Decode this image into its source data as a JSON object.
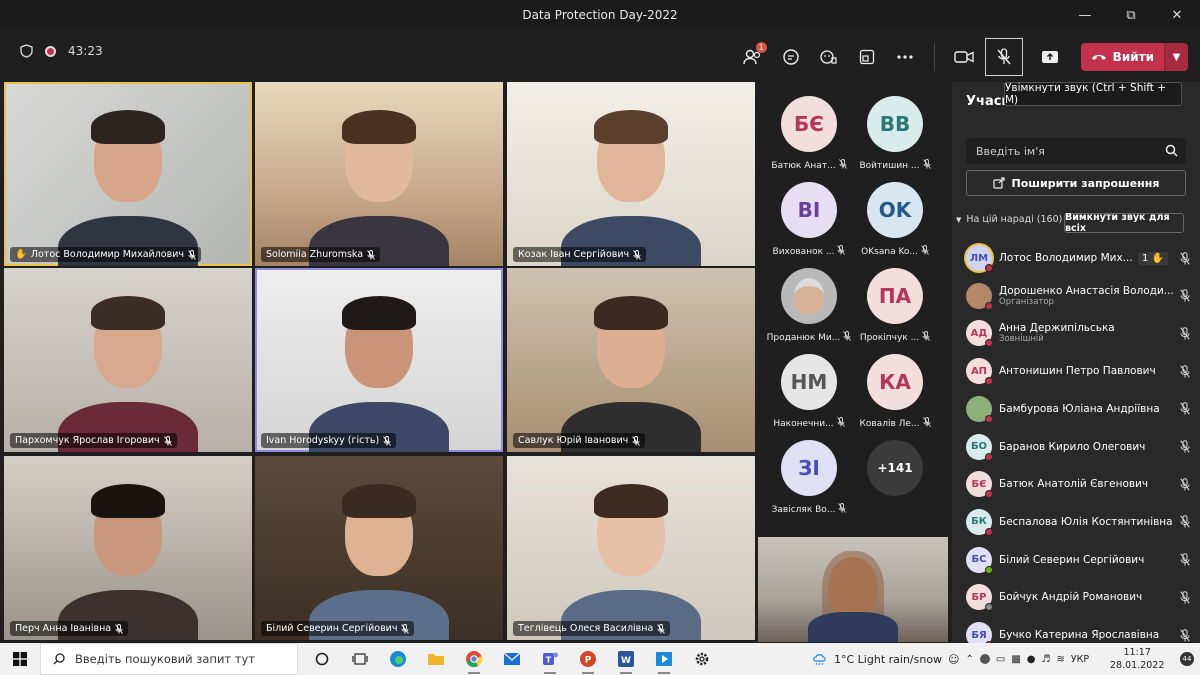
{
  "window": {
    "title": "Data Protection Day-2022"
  },
  "toolbar": {
    "timer": "43:23",
    "participants_badge": "1",
    "leave_label": "Вийти"
  },
  "tooltip": {
    "text": "Увімкнути звук (Ctrl + Shift + M)"
  },
  "video_tiles": [
    {
      "name": "Лотос Володимир Михайлович",
      "hand": true
    },
    {
      "name": "Solomiia Zhuromska"
    },
    {
      "name": "Козак Іван Сергійович"
    },
    {
      "name": "Пархомчук Ярослав Ігорович"
    },
    {
      "name": "Ivan Horodyskyy (гість)"
    },
    {
      "name": "Савлук Юрій Іванович"
    },
    {
      "name": "Перч Анна Іванівна"
    },
    {
      "name": "Білий Северин Сергійович"
    },
    {
      "name": "Теглівець Олеся Василівна"
    }
  ],
  "avatar_grid": [
    {
      "initials": "БЄ",
      "name": "Батюк Анат...",
      "color": "#f3dede",
      "text_color": "#b4375a"
    },
    {
      "initials": "ВВ",
      "name": "Войтишин ...",
      "color": "#d8ecec",
      "text_color": "#2e7777"
    },
    {
      "initials": "ВІ",
      "name": "Вихованок ...",
      "color": "#e8def3",
      "text_color": "#6a3fa0"
    },
    {
      "initials": "OK",
      "name": "OKsana Ko...",
      "color": "#d8e6f2",
      "text_color": "#235a8a"
    },
    {
      "initials": "",
      "name": "Проданюк Ми...",
      "color": "#b9b9b9",
      "text_color": "#333333"
    },
    {
      "initials": "ПА",
      "name": "Прокіпчук ...",
      "color": "#f3dede",
      "text_color": "#b4375a"
    },
    {
      "initials": "НМ",
      "name": "Наконечни...",
      "color": "#e6e6e6",
      "text_color": "#555555"
    },
    {
      "initials": "КА",
      "name": "Ковалів Ле...",
      "color": "#f3dede",
      "text_color": "#b4375a"
    },
    {
      "initials": "ЗІ",
      "name": "Завісляк Во...",
      "color": "#dfe0f3",
      "text_color": "#464eb8"
    },
    {
      "initials": "+141",
      "name": "",
      "color": "#3b3b3b",
      "text_color": "#ffffff"
    }
  ],
  "panel": {
    "title": "Учасн",
    "search_placeholder": "Введіть ім'я",
    "invite_label": "Поширити запрошення",
    "section_label": "На цій нараді (160)",
    "mute_all_label": "Вимкнути звук для всіх",
    "participants": [
      {
        "initials": "ЛМ",
        "name": "Лотос Володимир Мих...",
        "role": "",
        "hand": "1",
        "color": "#cfd3f0",
        "text_color": "#464eb8"
      },
      {
        "initials": "",
        "name": "Дорошенко Анастасія Володи...",
        "role": "Організатор",
        "color": "#b5876a",
        "text_color": "#ffffff"
      },
      {
        "initials": "АД",
        "name": "Анна Держипільська",
        "role": "Зовнішній",
        "color": "#f3dede",
        "text_color": "#b4375a"
      },
      {
        "initials": "АП",
        "name": "Антонишин Петро Павлович",
        "role": "",
        "color": "#f3dede",
        "text_color": "#b4375a"
      },
      {
        "initials": "",
        "name": "Бамбурова Юліана Андріївна",
        "role": "",
        "color": "#8db07a",
        "text_color": "#ffffff"
      },
      {
        "initials": "БО",
        "name": "Баранов Кирило Олегович",
        "role": "",
        "color": "#d8ecec",
        "text_color": "#2e7777"
      },
      {
        "initials": "БЄ",
        "name": "Батюк Анатолій Євгенович",
        "role": "",
        "color": "#f3dede",
        "text_color": "#b4375a"
      },
      {
        "initials": "БК",
        "name": "Беспалова Юлія Костянтинівна",
        "role": "",
        "color": "#d8ecec",
        "text_color": "#2e7777"
      },
      {
        "initials": "БС",
        "name": "Білий Северин Сергійович",
        "role": "",
        "color": "#dfe0f3",
        "text_color": "#464eb8"
      },
      {
        "initials": "БР",
        "name": "Бойчук Андрій Романович",
        "role": "",
        "color": "#f3dede",
        "text_color": "#b4375a"
      },
      {
        "initials": "БЯ",
        "name": "Бучко Катерина Ярославівна",
        "role": "",
        "color": "#dfe0f3",
        "text_color": "#464eb8"
      }
    ]
  },
  "taskbar": {
    "search_placeholder": "Введіть пошуковий запит тут",
    "weather": "1°C  Light rain/snow",
    "language": "УКР",
    "time": "11:17",
    "date": "28.01.2022",
    "notifications": "44"
  }
}
